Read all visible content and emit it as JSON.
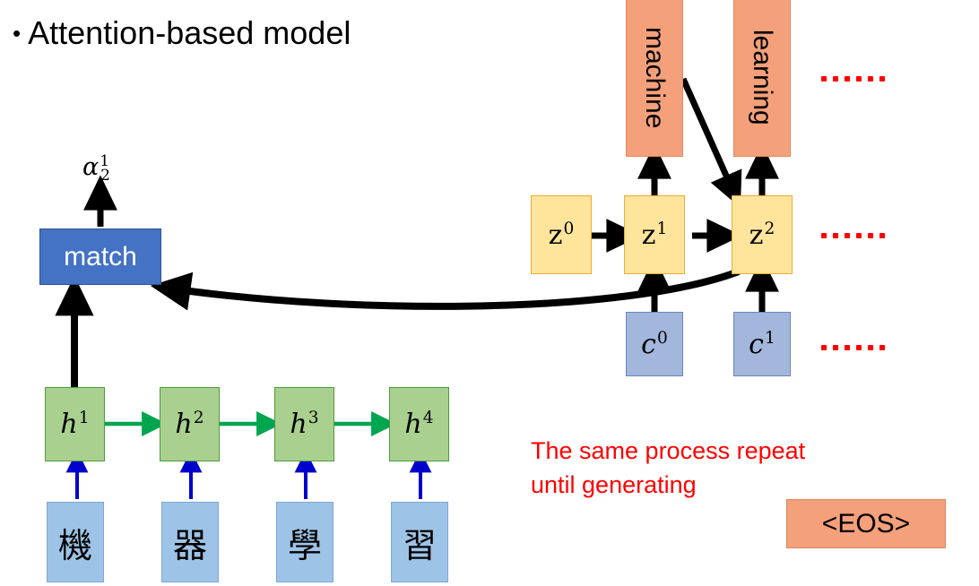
{
  "slide": {
    "title": "Attention-based model",
    "bullet_glyph": "•"
  },
  "attention": {
    "alpha_base": "α",
    "alpha_superscript": "1",
    "alpha_subscript": "2",
    "match_label": "match"
  },
  "encoder": {
    "hidden_states": [
      {
        "base": "h",
        "sup": "1"
      },
      {
        "base": "h",
        "sup": "2"
      },
      {
        "base": "h",
        "sup": "3"
      },
      {
        "base": "h",
        "sup": "4"
      }
    ],
    "input_tokens": [
      "機",
      "器",
      "學",
      "習"
    ]
  },
  "decoder": {
    "states": [
      {
        "base": "z",
        "sup": "0"
      },
      {
        "base": "z",
        "sup": "1"
      },
      {
        "base": "z",
        "sup": "2"
      }
    ],
    "contexts": [
      {
        "base": "c",
        "sup": "0"
      },
      {
        "base": "c",
        "sup": "1"
      }
    ],
    "outputs": [
      "machine",
      "learning"
    ],
    "eos_label": "<EOS>"
  },
  "note": {
    "text": "The same process repeat\nuntil generating"
  },
  "ellipses": {
    "dot_count": 6
  },
  "colors": {
    "match_fill": "#4472C4",
    "hidden_fill": "#A9D08E",
    "input_fill": "#9DC3E6",
    "decoder_fill": "#FFE49C",
    "context_fill": "#A3B6DC",
    "output_fill": "#F4A07A",
    "note_text": "#FF0000",
    "encoder_arrow": "#00A550",
    "input_arrow": "#0000CC",
    "attention_arrow": "#000000"
  }
}
